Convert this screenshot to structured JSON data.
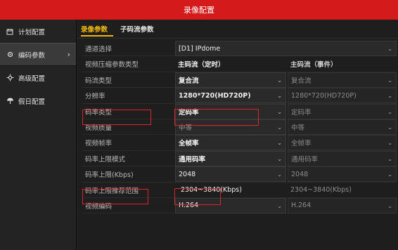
{
  "window": {
    "title": "录像配置"
  },
  "sidebar": {
    "items": [
      {
        "label": "计划配置",
        "icon": "calendar-icon"
      },
      {
        "label": "编码参数",
        "icon": "gear-icon",
        "active": true
      },
      {
        "label": "高级配置",
        "icon": "settings-icon"
      },
      {
        "label": "假日配置",
        "icon": "umbrella-icon"
      }
    ]
  },
  "tabs": [
    {
      "label": "录像参数",
      "active": true
    },
    {
      "label": "子码流参数"
    }
  ],
  "form": {
    "channel_label": "通道选择",
    "channel_value": "[D1] IPdome",
    "header_label": "视频压缩参数类型",
    "col1_header": "主码流（定时）",
    "col2_header": "主码流（事件）",
    "rows": [
      {
        "label": "码流类型",
        "v1": "复合流",
        "v2": "复合流"
      },
      {
        "label": "分辨率",
        "v1": "1280*720(HD720P)",
        "v2": "1280*720(HD720P)"
      },
      {
        "label": "码率类型",
        "v1": "定码率",
        "v2": "定码率"
      },
      {
        "label": "视频质量",
        "v1": "中等",
        "v2": "中等"
      },
      {
        "label": "视频帧率",
        "v1": "全帧率",
        "v2": "全帧率"
      },
      {
        "label": "码率上限模式",
        "v1": "通用码率",
        "v2": "通用码率"
      },
      {
        "label": "码率上限(Kbps)",
        "v1": "2048",
        "v2": "2048"
      },
      {
        "label": "码率上限推荐范围",
        "v1": "2304~3840(Kbps)",
        "v2": "2304~3840(Kbps)"
      },
      {
        "label": "视频编码",
        "v1": "H.264",
        "v2": "H.264"
      }
    ]
  },
  "colors": {
    "title_bar": "#d41a1a",
    "tab_active": "#f2b70a",
    "highlight": "#d8262b"
  }
}
